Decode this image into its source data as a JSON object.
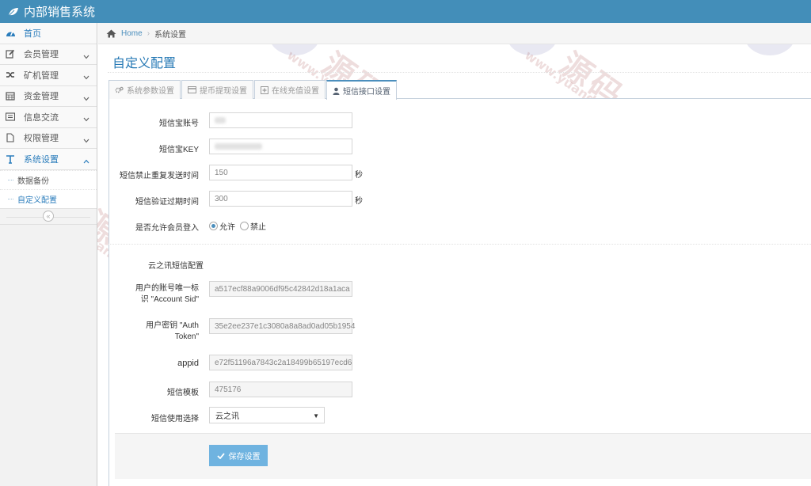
{
  "app": {
    "title": "内部销售系统"
  },
  "sidebar": {
    "items": [
      {
        "label": "首页",
        "icon": "dashboard-icon",
        "active": true
      },
      {
        "label": "会员管理",
        "icon": "edit-icon"
      },
      {
        "label": "矿机管理",
        "icon": "shuffle-icon"
      },
      {
        "label": "资金管理",
        "icon": "calendar-icon"
      },
      {
        "label": "信息交流",
        "icon": "list-alt-icon"
      },
      {
        "label": "权限管理",
        "icon": "file-icon"
      },
      {
        "label": "系统设置",
        "icon": "text-icon",
        "open": true
      }
    ],
    "submenu": [
      {
        "label": "数据备份"
      },
      {
        "label": "自定义配置",
        "current": true
      }
    ],
    "collapse_glyph": "«"
  },
  "breadcrumb": {
    "home": "Home",
    "current": "系统设置"
  },
  "page": {
    "title": "自定义配置"
  },
  "tabs": [
    {
      "label": "系统参数设置",
      "icon": "cogs-icon"
    },
    {
      "label": "提币提现设置",
      "icon": "credit-card-icon"
    },
    {
      "label": "在线充值设置",
      "icon": "plus-square-icon"
    },
    {
      "label": "短信接口设置",
      "icon": "user-icon",
      "active": true
    }
  ],
  "form": {
    "sms_account_label": "短信宝账号",
    "sms_key_label": "短信宝KEY",
    "resend_label": "短信禁止重复发送时间",
    "resend_value": "150",
    "resend_unit": "秒",
    "expire_label": "短信验证过期时间",
    "expire_value": "300",
    "expire_unit": "秒",
    "login_label": "是否允许会员登入",
    "login_allow": "允许",
    "login_deny": "禁止",
    "yzx_title": "云之讯短信配置",
    "account_sid_label": "用户的账号唯一标识 \"Account Sid\"",
    "account_sid_value": "a517ecf88a9006df95c42842d18a1aca",
    "auth_token_label": "用户密钥 \"Auth Token\"",
    "auth_token_value": "35e2ee237e1c3080a8a8ad0ad05b1954",
    "appid_label": "appid",
    "appid_value": "e72f51196a7843c2a18499b65197ecd6",
    "template_label": "短信模板",
    "template_value": "475176",
    "provider_label": "短信使用选择",
    "provider_value": "云之讯",
    "save_label": "保存设置"
  },
  "watermark": {
    "brand": "源码",
    "url": "www.yuandd.net"
  },
  "colors": {
    "navbar": "#438eb9",
    "accent": "#2679b5",
    "button": "#6fb3e0"
  }
}
